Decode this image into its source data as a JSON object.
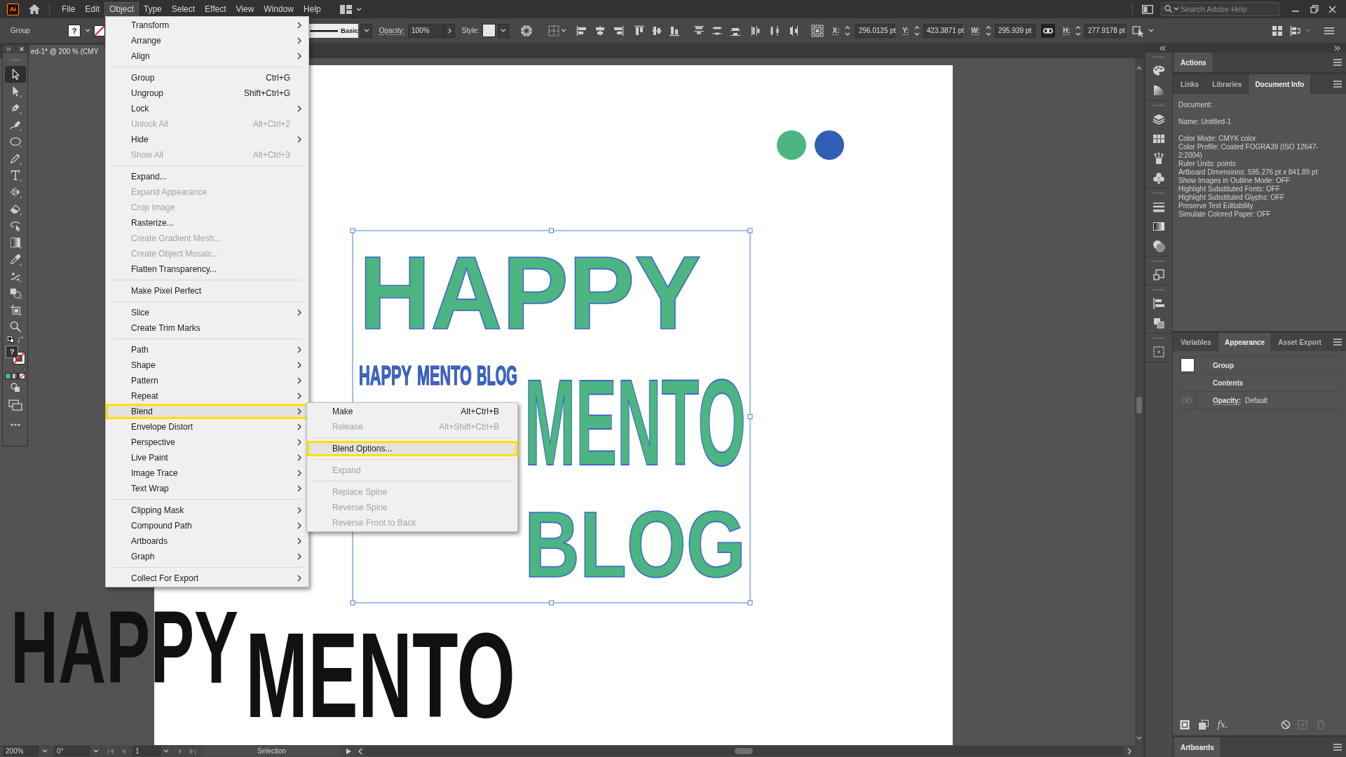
{
  "menubar": {
    "logo": "Ai",
    "menus": [
      {
        "label": "File",
        "selected": false
      },
      {
        "label": "Edit",
        "selected": false
      },
      {
        "label": "Object",
        "selected": true
      },
      {
        "label": "Type",
        "selected": false
      },
      {
        "label": "Select",
        "selected": false
      },
      {
        "label": "Effect",
        "selected": false
      },
      {
        "label": "View",
        "selected": false
      },
      {
        "label": "Window",
        "selected": false
      },
      {
        "label": "Help",
        "selected": false
      }
    ],
    "search": {
      "placeholder": "Search Adobe Help"
    }
  },
  "control_bar": {
    "selection": "Group",
    "fill": "?",
    "stroke_style": "Basic",
    "opacity_label": "Opacity:",
    "opacity": "100%",
    "style_label": "Style:",
    "fields": [
      {
        "label": "X:",
        "value": "296.0125 pt"
      },
      {
        "label": "Y:",
        "value": "423.3871 pt"
      },
      {
        "label": "W:",
        "value": "295.939 pt"
      },
      {
        "label": "H:",
        "value": "277.9178 pt"
      }
    ],
    "constrain_proportions": true
  },
  "document_tab": {
    "title": "ed-1* @ 200 % (CMY"
  },
  "toolbar": {
    "tools": [
      {
        "kind": "selection",
        "selected": true
      },
      {
        "kind": "direct-selection",
        "selected": false
      },
      {
        "kind": "pen",
        "selected": false
      },
      {
        "kind": "curvature",
        "selected": false
      },
      {
        "kind": "ellipse",
        "selected": false
      },
      {
        "kind": "pencil",
        "selected": false
      },
      {
        "kind": "type",
        "selected": false
      },
      {
        "kind": "reflect",
        "selected": false
      },
      {
        "kind": "eraser",
        "selected": false
      },
      {
        "kind": "lasso",
        "selected": false
      },
      {
        "kind": "gradient",
        "selected": false
      },
      {
        "kind": "eyedropper",
        "selected": false
      },
      {
        "kind": "puppet-warp",
        "selected": false
      },
      {
        "kind": "shape-builder",
        "selected": false
      },
      {
        "kind": "artboard",
        "selected": false
      },
      {
        "kind": "zoom",
        "selected": false
      }
    ],
    "fill": "?"
  },
  "object_menu": {
    "sections": [
      {
        "items": [
          {
            "label": "Transform",
            "submenu": true,
            "disabled": false,
            "highlighted": false
          },
          {
            "label": "Arrange",
            "submenu": true,
            "disabled": false,
            "highlighted": false
          },
          {
            "label": "Align",
            "submenu": true,
            "disabled": false,
            "highlighted": false
          }
        ]
      },
      {
        "items": [
          {
            "label": "Group",
            "shortcut": "Ctrl+G",
            "submenu": false,
            "disabled": false,
            "highlighted": false
          },
          {
            "label": "Ungroup",
            "shortcut": "Shift+Ctrl+G",
            "submenu": false,
            "disabled": false,
            "highlighted": false
          },
          {
            "label": "Lock",
            "submenu": true,
            "disabled": false,
            "highlighted": false
          },
          {
            "label": "Unlock All",
            "shortcut": "Alt+Ctrl+2",
            "submenu": false,
            "disabled": true,
            "highlighted": false
          },
          {
            "label": "Hide",
            "submenu": true,
            "disabled": false,
            "highlighted": false
          },
          {
            "label": "Show All",
            "shortcut": "Alt+Ctrl+3",
            "submenu": false,
            "disabled": true,
            "highlighted": false
          }
        ]
      },
      {
        "items": [
          {
            "label": "Expand...",
            "submenu": false,
            "disabled": false,
            "highlighted": false
          },
          {
            "label": "Expand Appearance",
            "submenu": false,
            "disabled": true,
            "highlighted": false
          },
          {
            "label": "Crop Image",
            "submenu": false,
            "disabled": true,
            "highlighted": false
          },
          {
            "label": "Rasterize...",
            "submenu": false,
            "disabled": false,
            "highlighted": false
          },
          {
            "label": "Create Gradient Mesh...",
            "submenu": false,
            "disabled": true,
            "highlighted": false
          },
          {
            "label": "Create Object Mosaic...",
            "submenu": false,
            "disabled": true,
            "highlighted": false
          },
          {
            "label": "Flatten Transparency...",
            "submenu": false,
            "disabled": false,
            "highlighted": false
          }
        ]
      },
      {
        "items": [
          {
            "label": "Make Pixel Perfect",
            "submenu": false,
            "disabled": false,
            "highlighted": false
          }
        ]
      },
      {
        "items": [
          {
            "label": "Slice",
            "submenu": true,
            "disabled": false,
            "highlighted": false
          },
          {
            "label": "Create Trim Marks",
            "submenu": false,
            "disabled": false,
            "highlighted": false
          }
        ]
      },
      {
        "items": [
          {
            "label": "Path",
            "submenu": true,
            "disabled": false,
            "highlighted": false
          },
          {
            "label": "Shape",
            "submenu": true,
            "disabled": false,
            "highlighted": false
          },
          {
            "label": "Pattern",
            "submenu": true,
            "disabled": false,
            "highlighted": false
          },
          {
            "label": "Repeat",
            "submenu": true,
            "disabled": false,
            "highlighted": false
          },
          {
            "label": "Blend",
            "submenu": true,
            "disabled": false,
            "highlighted": true
          },
          {
            "label": "Envelope Distort",
            "submenu": true,
            "disabled": false,
            "highlighted": false
          },
          {
            "label": "Perspective",
            "submenu": true,
            "disabled": false,
            "highlighted": false
          },
          {
            "label": "Live Paint",
            "submenu": true,
            "disabled": false,
            "highlighted": false
          },
          {
            "label": "Image Trace",
            "submenu": true,
            "disabled": false,
            "highlighted": false
          },
          {
            "label": "Text Wrap",
            "submenu": true,
            "disabled": false,
            "highlighted": false
          }
        ]
      },
      {
        "items": [
          {
            "label": "Clipping Mask",
            "submenu": true,
            "disabled": false,
            "highlighted": false
          },
          {
            "label": "Compound Path",
            "submenu": true,
            "disabled": false,
            "highlighted": false
          },
          {
            "label": "Artboards",
            "submenu": true,
            "disabled": false,
            "highlighted": false
          },
          {
            "label": "Graph",
            "submenu": true,
            "disabled": false,
            "highlighted": false
          }
        ]
      },
      {
        "items": [
          {
            "label": "Collect For Export",
            "submenu": true,
            "disabled": false,
            "highlighted": false
          }
        ]
      }
    ]
  },
  "blend_submenu": {
    "sections": [
      {
        "items": [
          {
            "label": "Make",
            "shortcut": "Alt+Ctrl+B",
            "submenu": false,
            "disabled": false,
            "highlighted": false
          },
          {
            "label": "Release",
            "shortcut": "Alt+Shift+Ctrl+B",
            "submenu": false,
            "disabled": true,
            "highlighted": false
          }
        ]
      },
      {
        "items": [
          {
            "label": "Blend Options...",
            "submenu": false,
            "disabled": false,
            "highlighted": true
          }
        ]
      },
      {
        "items": [
          {
            "label": "Expand",
            "submenu": false,
            "disabled": true,
            "highlighted": false
          }
        ]
      },
      {
        "items": [
          {
            "label": "Replace Spine",
            "submenu": false,
            "disabled": true,
            "highlighted": false
          },
          {
            "label": "Reverse Spine",
            "submenu": false,
            "disabled": true,
            "highlighted": false
          },
          {
            "label": "Reverse Front to Back",
            "submenu": false,
            "disabled": true,
            "highlighted": false
          }
        ]
      }
    ]
  },
  "artwork": {
    "dots": [
      {
        "color": "#4cb582"
      },
      {
        "color": "#2f5eb4"
      }
    ],
    "group": {
      "selected": true,
      "words": [
        "HAPPY",
        "MENTO",
        "BLOG"
      ],
      "blend_words": [
        "HAPPY",
        "MENTO",
        "BLOG"
      ]
    },
    "loose_words": [
      "HAPPY",
      "MENTO"
    ]
  },
  "status_bar": {
    "zoom": "200%",
    "rotation": "0°",
    "artboard": "1",
    "tool": "Selection"
  },
  "panels": {
    "actions": {
      "tabs": [
        {
          "label": "Actions",
          "selected": true
        }
      ]
    },
    "info": {
      "tabs": [
        {
          "label": "Links",
          "selected": false
        },
        {
          "label": "Libraries",
          "selected": false
        },
        {
          "label": "Document Info",
          "selected": true
        }
      ],
      "groups": [
        {
          "lines": [
            "Document:"
          ]
        },
        {
          "lines": [
            "Name: Untitled-1"
          ]
        },
        {
          "lines": [
            "Color Mode: CMYK color",
            "Color Profile: Coated FOGRA39 (ISO 12647-2:2004)",
            "Ruler Units: points",
            "Artboard Dimensions: 595.276 pt x 841.89 pt",
            "Show Images in Outline Mode: OFF",
            "Highlight Substituted Fonts: OFF",
            "Highlight Substituted Glyphs: OFF",
            "Preserve Text Editability",
            "Simulate Colored Paper: OFF"
          ]
        }
      ]
    },
    "appearance": {
      "tabs": [
        {
          "label": "Variables",
          "selected": false
        },
        {
          "label": "Appearance",
          "selected": true
        },
        {
          "label": "Asset Export",
          "selected": false
        }
      ],
      "rows": [
        {
          "kind": "object",
          "label": "Group"
        },
        {
          "kind": "contents",
          "label": "Contents"
        },
        {
          "kind": "attribute",
          "label": "Opacity:",
          "value": "Default",
          "visible": true
        }
      ],
      "effects_button": "fx."
    },
    "artboards": {
      "tabs": [
        {
          "label": "Artboards",
          "selected": true
        }
      ]
    }
  }
}
